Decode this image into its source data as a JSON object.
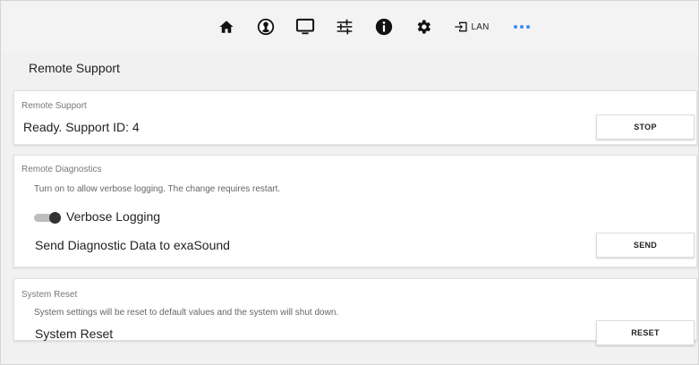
{
  "nav": {
    "icons": [
      "home-icon",
      "account-circle-icon",
      "monitor-icon",
      "sliders-icon",
      "info-icon",
      "gear-icon",
      "input-lan-icon",
      "more-dots-icon"
    ],
    "lan_label": "LAN",
    "accent_color": "#3d8ef0"
  },
  "page": {
    "title": "Remote Support"
  },
  "remote_support": {
    "header": "Remote Support",
    "status": "Ready. Support ID: 4",
    "stop_label": "STOP"
  },
  "remote_diagnostics": {
    "header": "Remote Diagnostics",
    "description": "Turn on to allow verbose logging. The change requires restart.",
    "verbose_label": "Verbose Logging",
    "verbose_enabled": false,
    "send_row_label": "Send Diagnostic Data to exaSound",
    "send_label": "SEND"
  },
  "system_reset": {
    "header": "System Reset",
    "description": "System settings will be reset to default values and the system will shut down.",
    "row_label": "System Reset",
    "reset_label": "RESET"
  }
}
